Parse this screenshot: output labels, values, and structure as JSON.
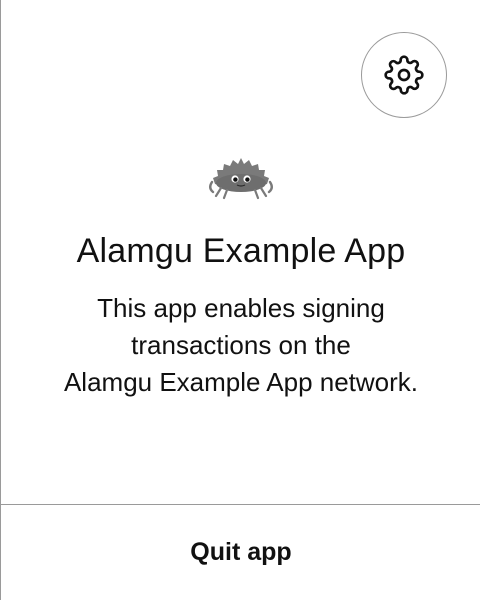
{
  "settings": {
    "icon": "gear-icon"
  },
  "logo": {
    "icon": "crab-logo-icon"
  },
  "header": {
    "title": "Alamgu Example App"
  },
  "description": {
    "lines": [
      "This app enables signing",
      "transactions on the",
      "Alamgu Example App network."
    ]
  },
  "footer": {
    "quit_label": "Quit app"
  },
  "colors": {
    "border": "#9a9a9a",
    "text": "#111111",
    "background": "#ffffff",
    "logo": "#7a7a7a"
  }
}
